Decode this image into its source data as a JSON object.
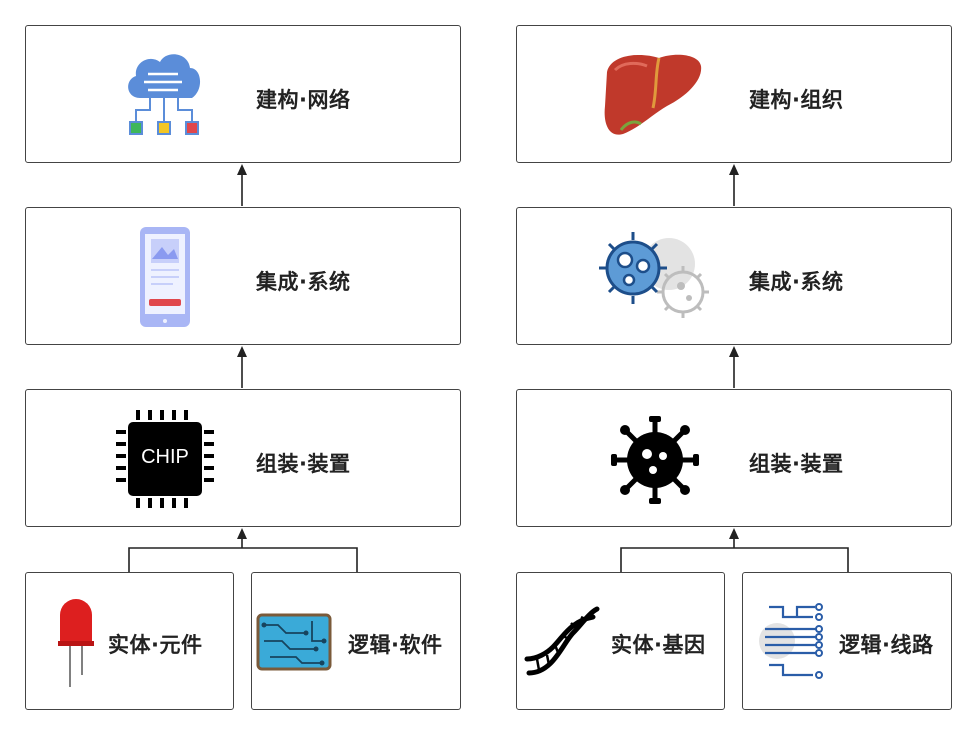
{
  "left": {
    "level4": {
      "label": "建构·网络",
      "icon": "cloud-network-icon"
    },
    "level3": {
      "label": "集成·系统",
      "icon": "smartphone-icon"
    },
    "level2": {
      "label": "组装·装置",
      "icon": "chip-icon",
      "chip_text": "CHIP"
    },
    "level1a": {
      "label": "实体·元件",
      "icon": "led-icon"
    },
    "level1b": {
      "label": "逻辑·软件",
      "icon": "circuit-board-icon"
    }
  },
  "right": {
    "level4": {
      "label": "建构·组织",
      "icon": "liver-icon"
    },
    "level3": {
      "label": "集成·系统",
      "icon": "virus-cells-icon"
    },
    "level2": {
      "label": "组装·装置",
      "icon": "virus-icon"
    },
    "level1a": {
      "label": "实体·基因",
      "icon": "dna-icon"
    },
    "level1b": {
      "label": "逻辑·线路",
      "icon": "circuit-lines-icon"
    }
  },
  "colors": {
    "border": "#444444",
    "arrow": "#222222",
    "cloud": "#5b8dd9",
    "led": "#dd1f1f",
    "phone": "#a9b6f5",
    "liver": "#c0392b"
  }
}
